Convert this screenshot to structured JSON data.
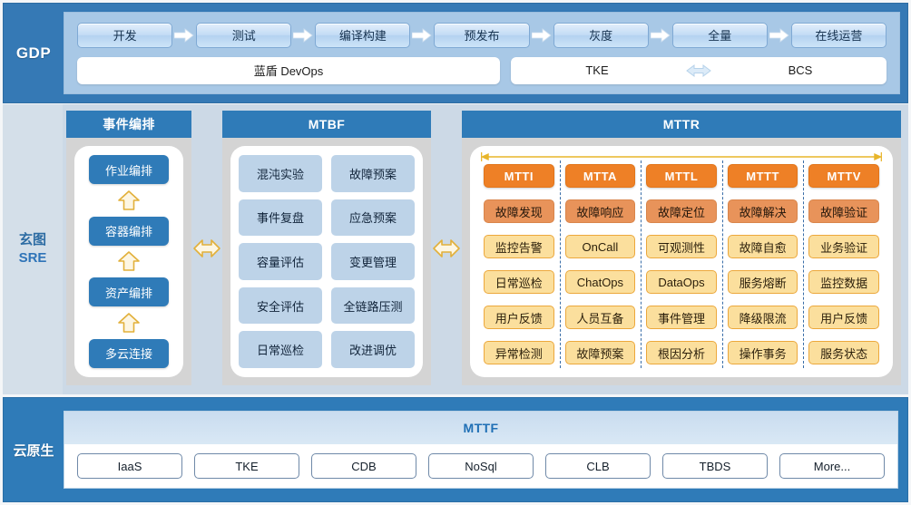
{
  "gdp": {
    "label": "GDP",
    "pipeline": [
      "开发",
      "测试",
      "编译构建",
      "预发布",
      "灰度",
      "全量",
      "在线运营"
    ],
    "arrow_icon": "right-arrow-icon",
    "tools": {
      "devops": "蓝盾 DevOps",
      "left": "TKE",
      "right": "BCS",
      "pair_arrow_icon": "double-arrow-icon"
    }
  },
  "sre": {
    "label_main": "玄图",
    "label_sub": "SRE",
    "columns": {
      "event": {
        "header": "事件编排",
        "items": [
          "作业编排",
          "容器编排",
          "资产编排",
          "多云连接"
        ],
        "connector_icon": "up-arrow-icon"
      },
      "mtbf": {
        "header": "MTBF",
        "items": [
          "混沌实验",
          "故障预案",
          "事件复盘",
          "应急预案",
          "容量评估",
          "变更管理",
          "安全评估",
          "全链路压测",
          "日常巡检",
          "改进调优"
        ]
      },
      "mttr": {
        "header": "MTTR",
        "range_arrow_icon": "double-headed-range-arrow-icon",
        "phases": [
          "MTTI",
          "MTTA",
          "MTTL",
          "MTTT",
          "MTTV"
        ],
        "stages": [
          "故障发现",
          "故障响应",
          "故障定位",
          "故障解决",
          "故障验证"
        ],
        "rows": [
          [
            "监控告警",
            "OnCall",
            "可观测性",
            "故障自愈",
            "业务验证"
          ],
          [
            "日常巡检",
            "ChatOps",
            "DataOps",
            "服务熔断",
            "监控数据"
          ],
          [
            "用户反馈",
            "人员互备",
            "事件管理",
            "降级限流",
            "用户反馈"
          ],
          [
            "异常检测",
            "故障预案",
            "根因分析",
            "操作事务",
            "服务状态"
          ]
        ]
      }
    },
    "between_arrow_icon": "double-arrow-icon"
  },
  "cloud": {
    "label": "云原生",
    "header": "MTTF",
    "items": [
      "IaaS",
      "TKE",
      "CDB",
      "NoSql",
      "CLB",
      "TBDS",
      "More..."
    ]
  },
  "colors": {
    "brand_blue": "#2f7bb8",
    "panel_blue": "#a8c8e6",
    "orange": "#ee8026",
    "salmon": "#e8935a",
    "yellow": "#fbdf9d",
    "gold": "#e8b52a",
    "band_bg": "#ccd9e6"
  }
}
